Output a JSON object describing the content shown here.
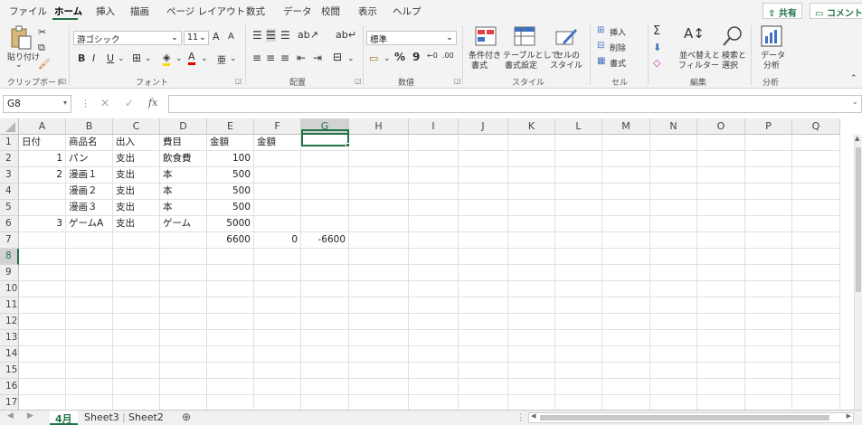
{
  "menu": {
    "tabs": [
      "ファイル",
      "ホーム",
      "挿入",
      "描画",
      "ページ レイアウト",
      "数式",
      "データ",
      "校閲",
      "表示",
      "ヘルプ"
    ],
    "share": "共有",
    "comment": "コメント"
  },
  "ribbon": {
    "clipboard": {
      "paste": "貼り付け",
      "label": "クリップボード"
    },
    "font": {
      "name": "游ゴシック",
      "size": "11",
      "grow": "A",
      "shrink": "A",
      "bold": "B",
      "italic": "I",
      "underline": "U",
      "label": "フォント"
    },
    "alignment": {
      "label": "配置"
    },
    "number": {
      "format": "標準",
      "percent": "%",
      "comma": "9",
      "label": "数値"
    },
    "styles": {
      "conditional": [
        "条件付き",
        "書式"
      ],
      "table": [
        "テーブルとして",
        "書式設定"
      ],
      "cell": [
        "セルの",
        "スタイル"
      ],
      "label": "スタイル"
    },
    "cells": {
      "insert": "挿入",
      "delete": "削除",
      "format": "書式",
      "label": "セル"
    },
    "editing": {
      "sort": [
        "並べ替えと",
        "フィルター"
      ],
      "find": [
        "検索と",
        "選択"
      ],
      "label": "編集"
    },
    "analysis": {
      "data": [
        "データ",
        "分析"
      ],
      "label": "分析"
    }
  },
  "formula_bar": {
    "name_box": "G8",
    "fx": "fx",
    "value": ""
  },
  "sheet": {
    "columns": [
      "A",
      "B",
      "C",
      "D",
      "E",
      "F",
      "G",
      "H",
      "I",
      "J",
      "K",
      "L",
      "M",
      "N",
      "O",
      "P",
      "Q"
    ],
    "rows": [
      "1",
      "2",
      "3",
      "4",
      "5",
      "6",
      "7",
      "8",
      "9",
      "10",
      "11",
      "12",
      "13",
      "14",
      "15",
      "16",
      "17"
    ],
    "selected_cell": "G8",
    "data": [
      [
        "日付",
        "商品名",
        "出入",
        "費目",
        "金額",
        "金額",
        ""
      ],
      [
        "1",
        "パン",
        "支出",
        "飲食費",
        "100",
        "",
        ""
      ],
      [
        "2",
        "漫画１",
        "支出",
        "本",
        "500",
        "",
        ""
      ],
      [
        "",
        "漫画２",
        "支出",
        "本",
        "500",
        "",
        ""
      ],
      [
        "",
        "漫画３",
        "支出",
        "本",
        "500",
        "",
        ""
      ],
      [
        "3",
        "ゲームA",
        "支出",
        "ゲーム",
        "5000",
        "",
        ""
      ],
      [
        "",
        "",
        "",
        "",
        "6600",
        "0",
        "-6600"
      ]
    ]
  },
  "sheet_tabs": [
    "4月",
    "Sheet3",
    "Sheet2"
  ],
  "active_tab": "4月"
}
